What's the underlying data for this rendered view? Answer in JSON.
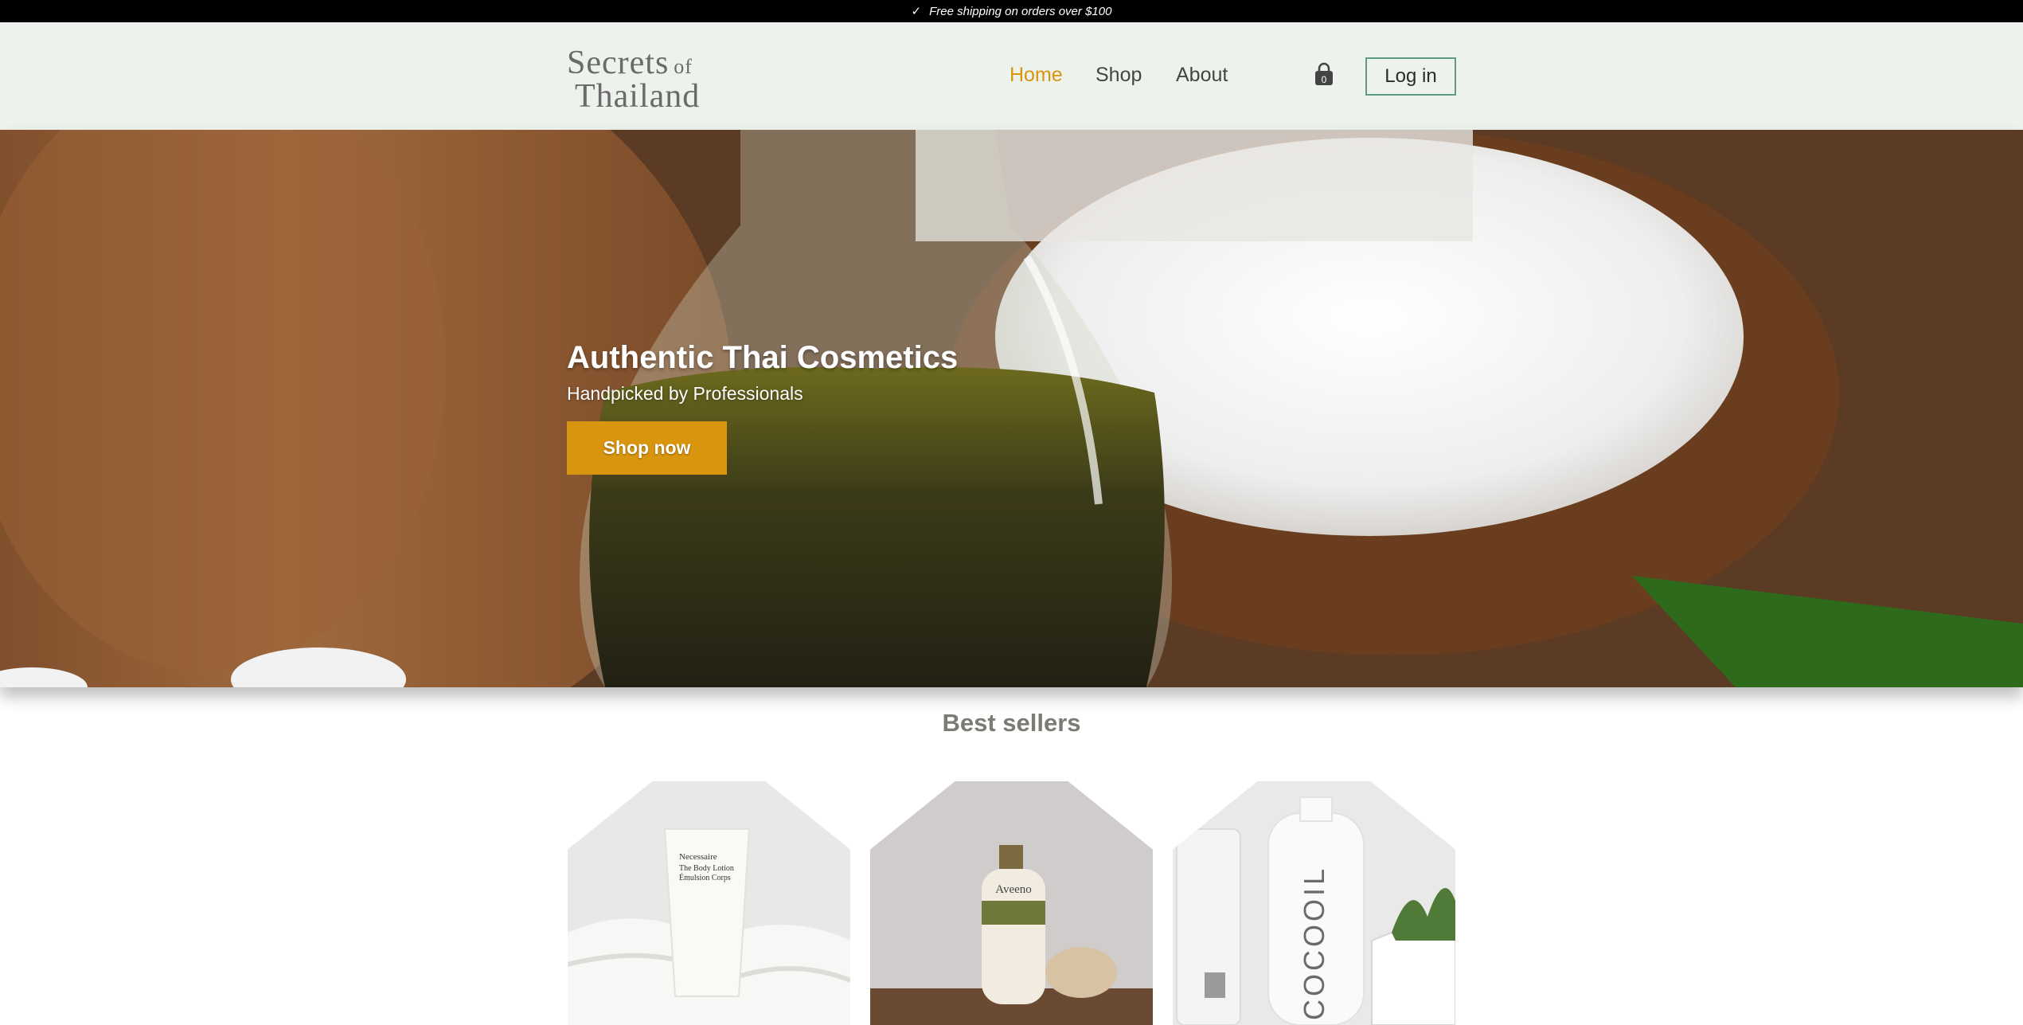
{
  "announcement": {
    "icon": "check-icon",
    "text": "Free shipping on orders over $100"
  },
  "header": {
    "logo": {
      "line1": "Secrets",
      "of": "of",
      "line2": "Thailand"
    },
    "nav": [
      {
        "label": "Home",
        "active": true
      },
      {
        "label": "Shop",
        "active": false
      },
      {
        "label": "About",
        "active": false
      }
    ],
    "cart": {
      "icon": "shopping-bag-icon",
      "count": "0"
    },
    "login_label": "Log in"
  },
  "hero": {
    "title": "Authentic Thai Cosmetics",
    "subtitle": "Handpicked by Professionals",
    "cta_label": "Shop now"
  },
  "best_sellers": {
    "title": "Best sellers",
    "products": [
      {
        "tube_text_1": "Necessaire",
        "tube_text_2": "The Body Lotion",
        "tube_text_3": "Émulsion Corps"
      },
      {
        "bottle_text": "Aveeno"
      },
      {
        "bottle_text": "COCOOIL"
      }
    ]
  },
  "colors": {
    "accent": "#d9950e",
    "header_bg": "#edf2ec",
    "login_border": "#5f9a86",
    "announcement_bg": "#000000"
  }
}
